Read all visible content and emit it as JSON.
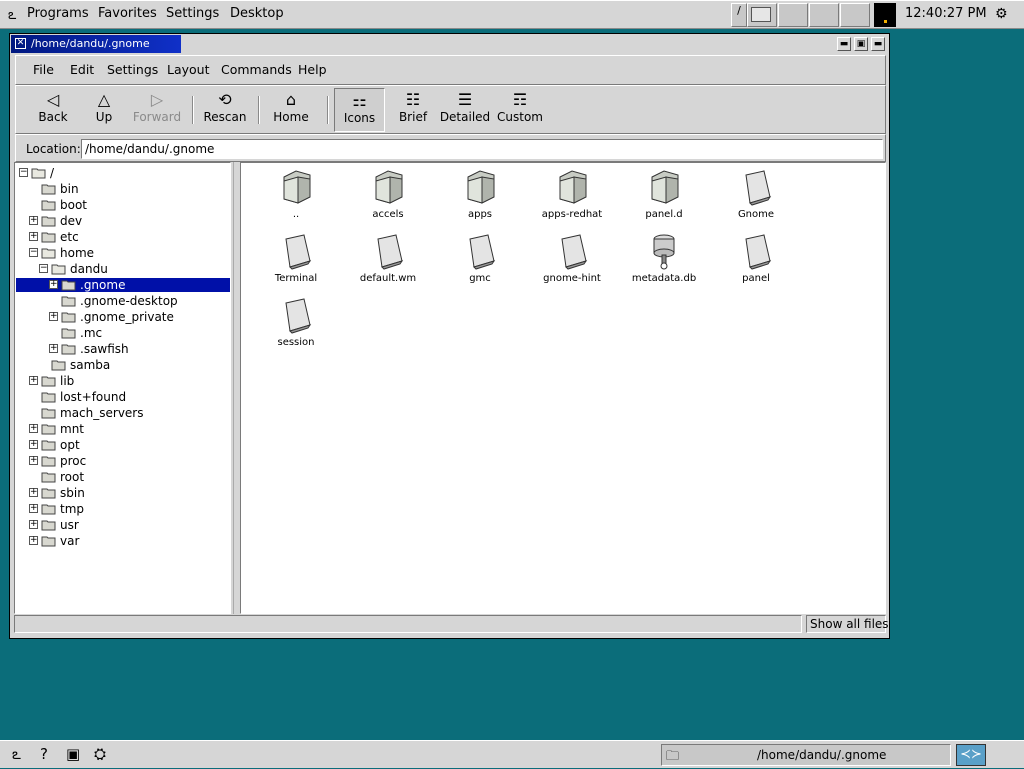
{
  "top_panel": {
    "menus": [
      "Programs",
      "Favorites",
      "Settings",
      "Desktop"
    ],
    "clock": "12:40:27 PM",
    "pager_first": "/"
  },
  "window": {
    "title": "/home/dandu/.gnome",
    "menu": [
      "File",
      "Edit",
      "Settings",
      "Layout",
      "Commands",
      "Help"
    ],
    "toolbar": [
      {
        "label": "Back",
        "icon": "back-arrow-icon",
        "enabled": true
      },
      {
        "label": "Up",
        "icon": "up-arrow-icon",
        "enabled": true
      },
      {
        "label": "Forward",
        "icon": "forward-arrow-icon",
        "enabled": false
      },
      {
        "label": "Rescan",
        "icon": "rescan-icon",
        "enabled": true
      },
      {
        "label": "Home",
        "icon": "home-icon",
        "enabled": true
      },
      {
        "label": "Icons",
        "icon": "icons-view-icon",
        "enabled": true,
        "selected": true
      },
      {
        "label": "Brief",
        "icon": "brief-view-icon",
        "enabled": true
      },
      {
        "label": "Detailed",
        "icon": "detailed-view-icon",
        "enabled": true
      },
      {
        "label": "Custom",
        "icon": "custom-view-icon",
        "enabled": true
      }
    ],
    "location_label": "Location:",
    "location_value": "/home/dandu/.gnome",
    "tree": [
      {
        "label": "/",
        "depth": 0,
        "expander": "-"
      },
      {
        "label": "bin",
        "depth": 1,
        "expander": ""
      },
      {
        "label": "boot",
        "depth": 1,
        "expander": ""
      },
      {
        "label": "dev",
        "depth": 1,
        "expander": "+"
      },
      {
        "label": "etc",
        "depth": 1,
        "expander": "+"
      },
      {
        "label": "home",
        "depth": 1,
        "expander": "-"
      },
      {
        "label": "dandu",
        "depth": 2,
        "expander": "-"
      },
      {
        "label": ".gnome",
        "depth": 3,
        "expander": "+",
        "selected": true
      },
      {
        "label": ".gnome-desktop",
        "depth": 3,
        "expander": ""
      },
      {
        "label": ".gnome_private",
        "depth": 3,
        "expander": "+"
      },
      {
        "label": ".mc",
        "depth": 3,
        "expander": ""
      },
      {
        "label": ".sawfish",
        "depth": 3,
        "expander": "+"
      },
      {
        "label": "samba",
        "depth": 2,
        "expander": ""
      },
      {
        "label": "lib",
        "depth": 1,
        "expander": "+"
      },
      {
        "label": "lost+found",
        "depth": 1,
        "expander": ""
      },
      {
        "label": "mach_servers",
        "depth": 1,
        "expander": ""
      },
      {
        "label": "mnt",
        "depth": 1,
        "expander": "+"
      },
      {
        "label": "opt",
        "depth": 1,
        "expander": "+"
      },
      {
        "label": "proc",
        "depth": 1,
        "expander": "+"
      },
      {
        "label": "root",
        "depth": 1,
        "expander": ""
      },
      {
        "label": "sbin",
        "depth": 1,
        "expander": "+"
      },
      {
        "label": "tmp",
        "depth": 1,
        "expander": "+"
      },
      {
        "label": "usr",
        "depth": 1,
        "expander": "+"
      },
      {
        "label": "var",
        "depth": 1,
        "expander": "+"
      }
    ],
    "files": [
      {
        "name": "..",
        "type": "folder"
      },
      {
        "name": "accels",
        "type": "folder"
      },
      {
        "name": "apps",
        "type": "folder"
      },
      {
        "name": "apps-redhat",
        "type": "folder"
      },
      {
        "name": "panel.d",
        "type": "folder"
      },
      {
        "name": "Gnome",
        "type": "file"
      },
      {
        "name": "Terminal",
        "type": "file"
      },
      {
        "name": "default.wm",
        "type": "file"
      },
      {
        "name": "gmc",
        "type": "file"
      },
      {
        "name": "gnome-hint",
        "type": "file"
      },
      {
        "name": "metadata.db",
        "type": "database"
      },
      {
        "name": "panel",
        "type": "file"
      },
      {
        "name": "session",
        "type": "file"
      }
    ],
    "status_button": "Show all files"
  },
  "bottom_panel": {
    "task_label": "/home/dandu/.gnome"
  }
}
